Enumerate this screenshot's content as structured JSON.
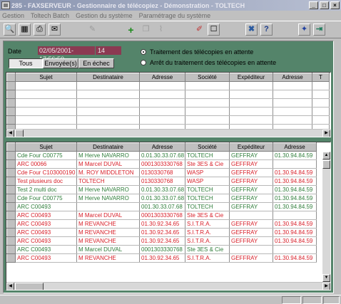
{
  "window": {
    "title": "285 - FAXSERVEUR - Gestionnaire de télécopiez - Démonstration - TOLTECH",
    "buttons": [
      "_",
      "□",
      "×"
    ]
  },
  "menu": [
    "Gestion",
    "Toltech Batch",
    "Gestion du système",
    "Paramétrage du système"
  ],
  "toolbar": {
    "icons": [
      {
        "name": "preview-icon",
        "glyph": "🔍"
      },
      {
        "name": "fax-machine-icon",
        "glyph": "📠"
      },
      {
        "name": "print-icon",
        "glyph": "🖨"
      },
      {
        "name": "mail-icon",
        "glyph": "✉"
      },
      {
        "name": "edit-icon",
        "glyph": "✎"
      },
      {
        "name": "add-icon",
        "glyph": "✚"
      },
      {
        "name": "copy-icon",
        "glyph": "❐"
      },
      {
        "name": "delete-icon",
        "glyph": "⌇"
      },
      {
        "name": "eraser-icon",
        "glyph": "✐"
      },
      {
        "name": "blank-page-icon",
        "glyph": "☐"
      },
      {
        "name": "tools-icon",
        "glyph": "✖"
      },
      {
        "name": "help-icon",
        "glyph": "?"
      },
      {
        "name": "wizard-icon",
        "glyph": "✦"
      },
      {
        "name": "exit-icon",
        "glyph": "⇥"
      }
    ],
    "colors": {
      "add": "#1a8a1a",
      "tools": "#2a5aa0",
      "help": "#1a3a8a",
      "eraser": "#c03030",
      "wizard": "#2040a0",
      "exit": "#1a7a5a"
    }
  },
  "filters": {
    "date_label": "Date",
    "date_value": "02/05/2001-17:56:50",
    "count_value": "14",
    "buttons": [
      "Tous",
      "Envoyée(s)",
      "En échec"
    ],
    "active": "Tous",
    "radios": [
      {
        "label": "Traitement des télécopies en attente",
        "selected": true
      },
      {
        "label": "Arrêt du traitement des télécopies en attente",
        "selected": false
      }
    ]
  },
  "pending_grid": {
    "columns": [
      "Sujet",
      "Destinataire",
      "Adresse",
      "Société",
      "Expéditeur",
      "Adresse",
      "T"
    ],
    "rows": 6
  },
  "sent_grid": {
    "columns": [
      "Sujet",
      "Destinataire",
      "Adresse",
      "Société",
      "Expéditeur",
      "Adresse"
    ],
    "colors": {
      "green": "#2e7d3a",
      "red": "#d8202a"
    },
    "rows": [
      {
        "c": "green",
        "cells": [
          "Cde Four C00775",
          "M Herve NAVARRO",
          "0.01.30.33.07.68",
          "TOLTECH",
          "GEFFRAY",
          "01.30.94.84.59"
        ]
      },
      {
        "c": "red",
        "cells": [
          "ARC 00066",
          "M Marcel DUVAL",
          "0001303330768",
          "Ste 3ES & Cie",
          "GEFFRAY",
          ""
        ]
      },
      {
        "c": "red",
        "cells": [
          "Cde Four C103000190",
          "M. ROY MIDDLETON",
          "0130330768",
          "WASP",
          "GEFFRAY",
          "01.30.94.84.59"
        ]
      },
      {
        "c": "red",
        "cells": [
          "Test plusieurs doc",
          "TOLTECH",
          "0130330768",
          "WASP",
          "GEFFRAY",
          "01.30.94.84.59"
        ]
      },
      {
        "c": "green",
        "cells": [
          "Test 2 multi doc",
          "M Herve NAVARRO",
          "0.01.30.33.07.68",
          "TOLTECH",
          "GEFFRAY",
          "01.30.94.84.59"
        ]
      },
      {
        "c": "green",
        "cells": [
          "Cde Four C00775",
          "M Herve NAVARRO",
          "0.01.30.33.07.68",
          "TOLTECH",
          "GEFFRAY",
          "01.30.94.84.59"
        ]
      },
      {
        "c": "green",
        "cells": [
          "ARC C00493",
          "",
          "001.30.33.07.68",
          "TOLTECH",
          "GEFFRAY",
          "01.30.94.84.59"
        ]
      },
      {
        "c": "red",
        "cells": [
          "ARC C00493",
          "M Marcel DUVAL",
          "0001303330768",
          "Ste 3ES & Cie",
          "",
          ""
        ]
      },
      {
        "c": "red",
        "cells": [
          "ARC C00493",
          "M REVANCHE",
          "01.30.92.34.65",
          "S.I.T.R.A.",
          "GEFFRAY",
          "01.30.94.84.59"
        ]
      },
      {
        "c": "red",
        "cells": [
          "ARC C00493",
          "M REVANCHE",
          "01.30.92.34.65",
          "S.I.T.R.A.",
          "GEFFRAY",
          "01.30.94.84.59"
        ]
      },
      {
        "c": "red",
        "cells": [
          "ARC C00493",
          "M REVANCHE",
          "01.30.92.34.65",
          "S.I.T.R.A.",
          "GEFFRAY",
          "01.30.94.84.59"
        ]
      },
      {
        "c": "green",
        "cells": [
          "ARC C00493",
          "M Marcel DUVAL",
          "0001303330768",
          "Ste 3ES & Cie",
          "",
          ""
        ]
      },
      {
        "c": "red",
        "cells": [
          "ARC C00493",
          "M REVANCHE",
          "01.30.92.34.65",
          "S.I.T.R.A.",
          "GEFFRAY",
          "01.30.94.84.59"
        ]
      }
    ]
  }
}
